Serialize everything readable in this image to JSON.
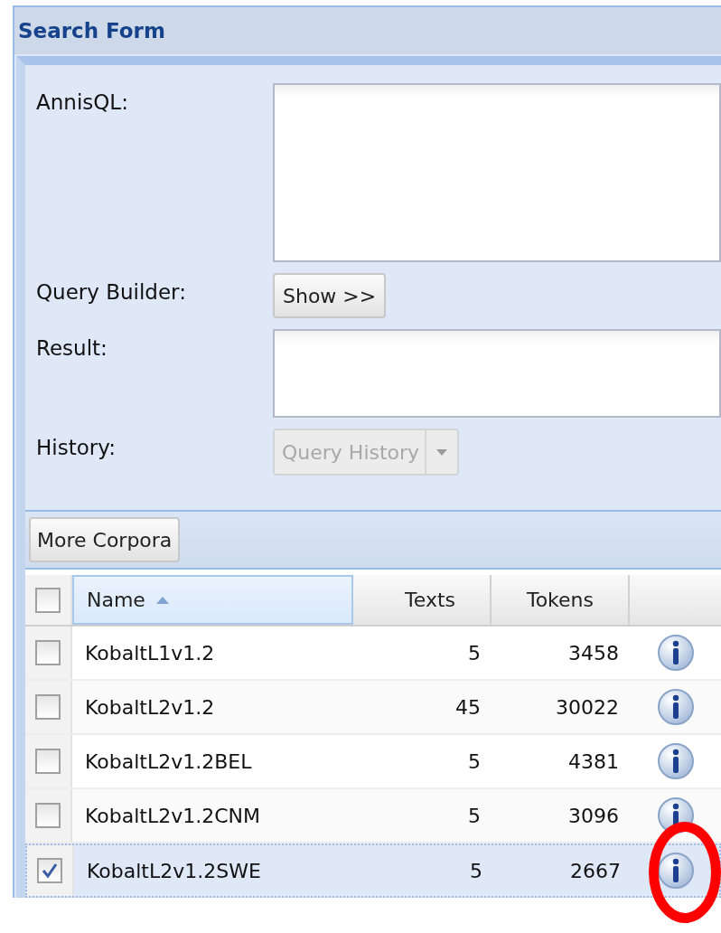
{
  "panel": {
    "title": "Search Form"
  },
  "form": {
    "rows": [
      {
        "kind": "query_area",
        "label": "AnnisQL:"
      },
      {
        "kind": "button",
        "label": "Query Builder:",
        "button": "Show >>"
      },
      {
        "kind": "result_area",
        "label": "Result:"
      },
      {
        "kind": "combo",
        "label": "History:",
        "placeholder": "Query History",
        "disabled": true
      }
    ]
  },
  "toolbar": {
    "button": "More Corpora"
  },
  "grid": {
    "header_checked": false,
    "columns": [
      {
        "label": "Name",
        "sorted": true
      },
      {
        "label": "Texts",
        "sorted": false
      },
      {
        "label": "Tokens",
        "sorted": false
      }
    ],
    "rows": [
      {
        "name": "KobaltL1v1.2",
        "texts": "5",
        "tokens": "3458",
        "checked": false,
        "selected": false
      },
      {
        "name": "KobaltL2v1.2",
        "texts": "45",
        "tokens": "30022",
        "checked": false,
        "selected": false
      },
      {
        "name": "KobaltL2v1.2BEL",
        "texts": "5",
        "tokens": "4381",
        "checked": false,
        "selected": false
      },
      {
        "name": "KobaltL2v1.2CNM",
        "texts": "5",
        "tokens": "3096",
        "checked": false,
        "selected": false
      },
      {
        "name": "KobaltL2v1.2SWE",
        "texts": "5",
        "tokens": "2667",
        "checked": true,
        "selected": true
      }
    ]
  }
}
